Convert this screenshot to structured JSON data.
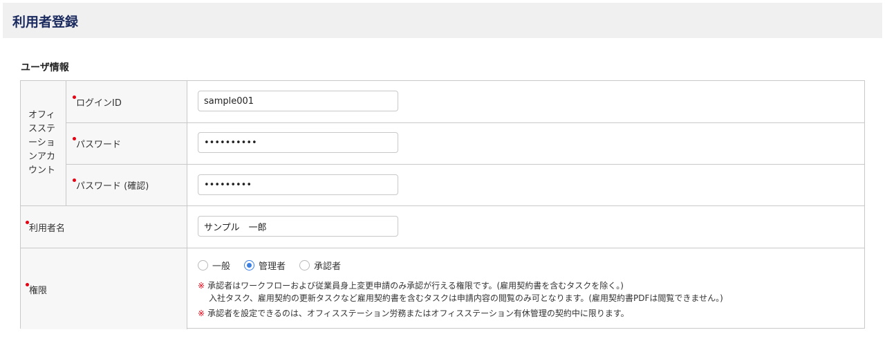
{
  "header": {
    "title": "利用者登録"
  },
  "section": {
    "title": "ユーザ情報"
  },
  "office_account": {
    "group_label": "オフィスステーションアカウント",
    "login_id": {
      "label": "ログインID",
      "value": "sample001"
    },
    "password": {
      "label": "パスワード",
      "value": "••••••••••"
    },
    "password_confirm": {
      "label": "パスワード (確認)",
      "value": "•••••••••"
    }
  },
  "user_name": {
    "label": "利用者名",
    "value": "サンプル　一郎"
  },
  "permission": {
    "label": "権限",
    "options": [
      {
        "label": "一般",
        "selected": false
      },
      {
        "label": "管理者",
        "selected": true
      },
      {
        "label": "承認者",
        "selected": false
      }
    ],
    "note_mark": "※",
    "notes": [
      "承認者はワークフローおよび従業員身上変更申請のみ承認が行える権限です。(雇用契約書を含むタスクを除く。)",
      "入社タスク、雇用契約の更新タスクなど雇用契約書を含むタスクは申請内容の閲覧のみ可となります。(雇用契約書PDFは閲覧できません。)",
      "承認者を設定できるのは、オフィスステーション労務またはオフィスステーション有休管理の契約中に限ります。"
    ]
  },
  "colors": {
    "title": "#1a2a5e",
    "required": "#e60012",
    "radio_selected": "#3b7fe3",
    "border": "#c8c8c8",
    "label_bg": "#f7f7f7"
  }
}
